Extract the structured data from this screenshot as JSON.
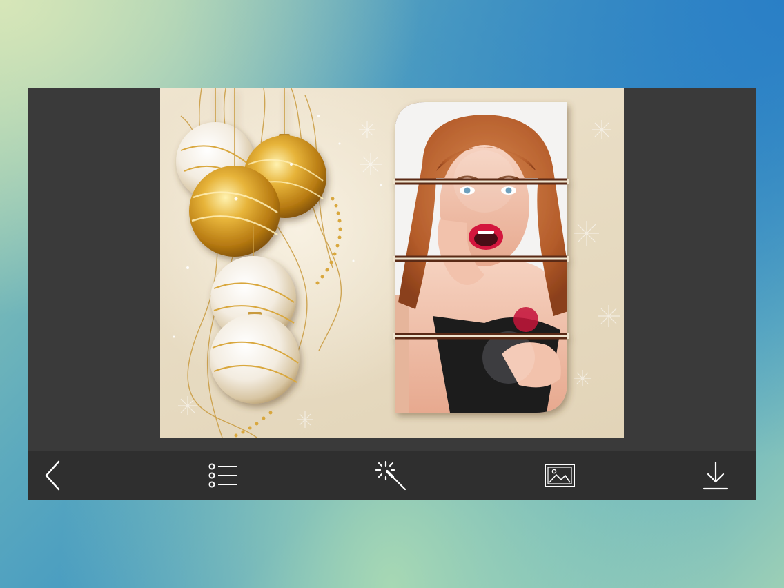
{
  "app": {
    "frame_color": "#3a3a3a",
    "toolbar_color": "#2f2f2f"
  },
  "canvas": {
    "background_theme": "christmas-ornaments",
    "photo_frame": "four-strip-collage"
  },
  "toolbar": {
    "buttons": [
      {
        "id": "back",
        "icon": "chevron-left-icon"
      },
      {
        "id": "frames-list",
        "icon": "list-icon"
      },
      {
        "id": "effects",
        "icon": "magic-wand-icon"
      },
      {
        "id": "gallery",
        "icon": "image-icon"
      },
      {
        "id": "save",
        "icon": "download-icon"
      }
    ]
  }
}
